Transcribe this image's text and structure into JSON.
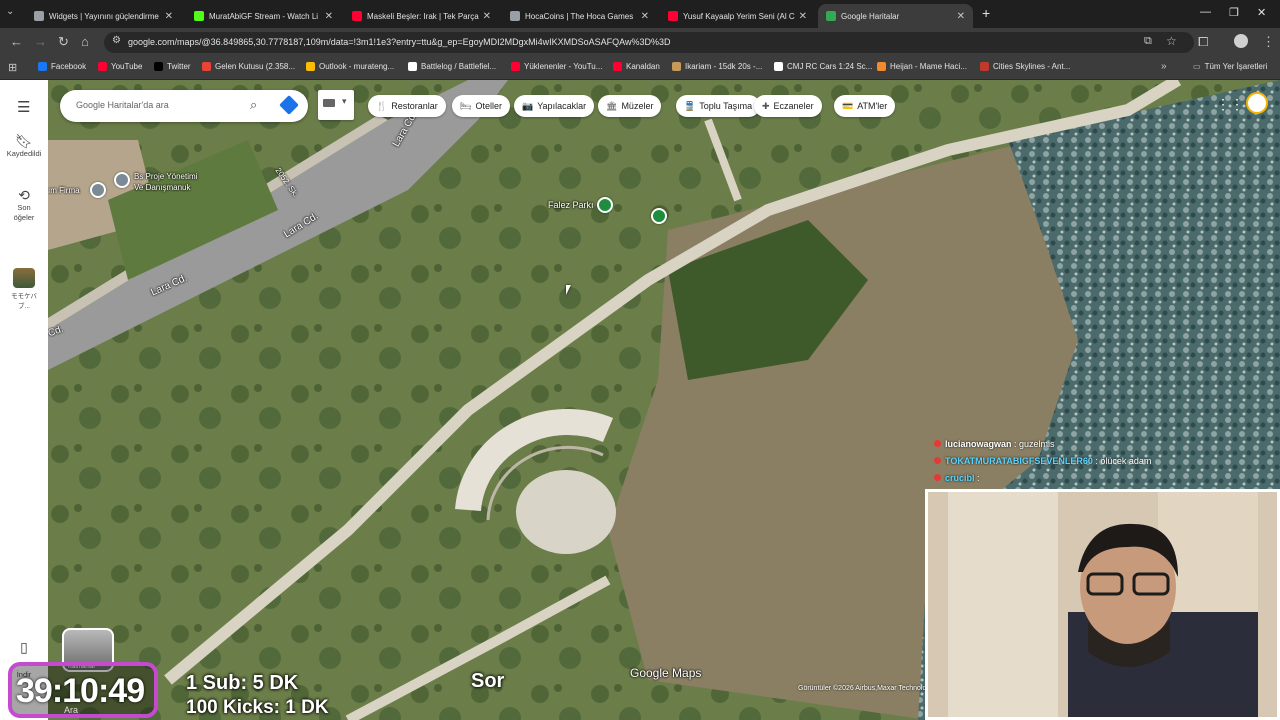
{
  "tabs": [
    {
      "title": "Widgets | Yayınını güçlendirme",
      "color": "#9aa0a6"
    },
    {
      "title": "MuratAbiGF Stream - Watch Li",
      "color": "#53fc18"
    },
    {
      "title": "Maskeli Beşler: Irak | Tek Parça",
      "color": "#ff0033"
    },
    {
      "title": "HocaCoins | The Hoca Games",
      "color": "#9aa0a6"
    },
    {
      "title": "Yusuf Kayaalp Yerim Seni (Al CC",
      "color": "#ff0033"
    },
    {
      "title": "Google Haritalar",
      "color": "#34a853"
    }
  ],
  "url": "google.com/maps/@36.849865,30.7778187,109m/data=!3m1!1e3?entry=ttu&g_ep=EgoyMDI2MDgxMi4wIKXMDSoASAFQAw%3D%3D",
  "bookmarks": [
    {
      "label": "Facebook",
      "color": "#1877f2"
    },
    {
      "label": "YouTube",
      "color": "#ff0033"
    },
    {
      "label": "Twitter",
      "color": "#000000"
    },
    {
      "label": "Gelen Kutusu (2.358...",
      "color": "#ea4335"
    },
    {
      "label": "Outlook - murateng...",
      "color": "#fbbc04"
    },
    {
      "label": "Battlelog / Battlefiel...",
      "color": "#ffffff"
    },
    {
      "label": "Yüklenenler - YouTu...",
      "color": "#ff0033"
    },
    {
      "label": "Kanaldan",
      "color": "#ff0033"
    },
    {
      "label": "Ikariam - 15dk 20s -...",
      "color": "#c89a5a"
    },
    {
      "label": "CMJ RC Cars 1:24 Sc...",
      "color": "#ffffff"
    },
    {
      "label": "Heijan - Mame Haci...",
      "color": "#f28b30"
    },
    {
      "label": "Cities Skylines - Ant...",
      "color": "#c0392b"
    }
  ],
  "bookmarks_folder": "Tüm Yer İşaretleri",
  "rail": {
    "saved": "Kaydedildi",
    "recent_line1": "Son",
    "recent_line2": "öğeler",
    "app_line1": "モモケバ",
    "app_line2": "ブ...",
    "bottom_label": "İndir"
  },
  "search": {
    "placeholder": "Google Haritalar'da ara"
  },
  "chips": [
    {
      "label": "Restoranlar",
      "icon": "🍴"
    },
    {
      "label": "Oteller",
      "icon": "🛏"
    },
    {
      "label": "Yapılacaklar",
      "icon": "📷"
    },
    {
      "label": "Müzeler",
      "icon": "🏛"
    },
    {
      "label": "Toplu Taşıma",
      "icon": "🚆"
    },
    {
      "label": "Eczaneler",
      "icon": "✚"
    },
    {
      "label": "ATM'ler",
      "icon": "💳"
    }
  ],
  "map_labels": {
    "street1": "Lara Cd.",
    "street2": "Lara Cd.",
    "street3": "Lara Cd.",
    "street4": "Cd.",
    "street5": "2052. Sk.",
    "poi1_line1": "Bs Proje Yönetimi",
    "poi1_line2": "Ve Danışmanuk",
    "poi2": "ım Firma",
    "park": "Falez Parkı",
    "watermark": "Google Maps",
    "copyright": "Görüntüler ©2026 Airbus,Maxar Technolo",
    "layers_label": "Katmanlar"
  },
  "chat": [
    {
      "user": "lucianowagwan",
      "message": "guzelmis",
      "color": "#ffffff"
    },
    {
      "user": "TOKATMURATABIGFSEVENLER60",
      "message": "ölücek adam",
      "color": "#5ad4ff"
    },
    {
      "user": "crucibl",
      "message": "",
      "color": "#5ad4ff"
    }
  ],
  "overlay": {
    "timer": "39:10:49",
    "goal1": "1 Sub: 5 DK",
    "goal2": "100 Kicks: 1 DK",
    "partial": "Sor",
    "taskbar_search": "Ara"
  }
}
